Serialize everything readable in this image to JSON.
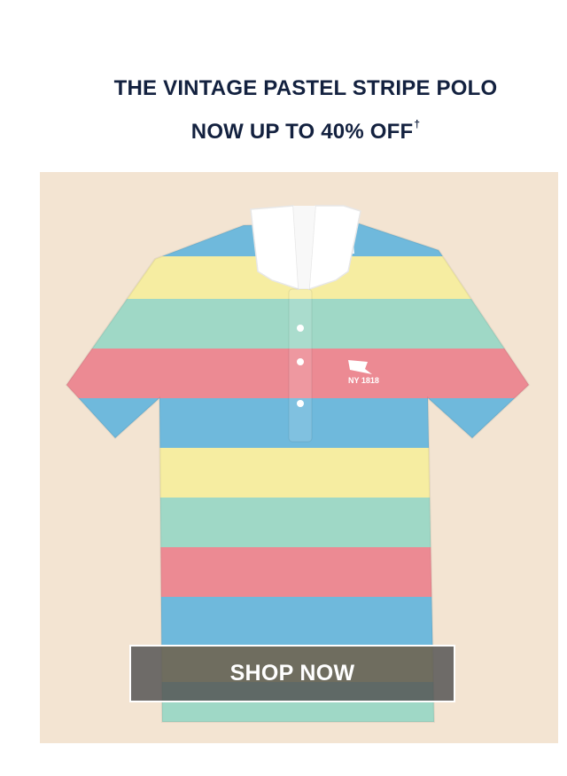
{
  "promo": {
    "headline_line1": "THE VINTAGE PASTEL STRIPE POLO",
    "headline_line2": "NOW UP TO 40% OFF",
    "headline_mark": "†",
    "embroidery_text": "NY 1818",
    "cta_label": "SHOP NOW"
  },
  "colors": {
    "headline": "#13213f",
    "background": "#f3e4d2",
    "stripe_blue": "#6fb9dc",
    "stripe_yellow": "#f6eda1",
    "stripe_green": "#9fd8c6",
    "stripe_pink": "#ec8a93",
    "collar": "#ffffff",
    "button_overlay": "#505050"
  },
  "product": {
    "name": "vintage pastel stripe polo",
    "stripe_order": [
      "blue",
      "yellow",
      "green",
      "pink",
      "blue",
      "yellow",
      "green",
      "pink",
      "blue",
      "green"
    ]
  }
}
